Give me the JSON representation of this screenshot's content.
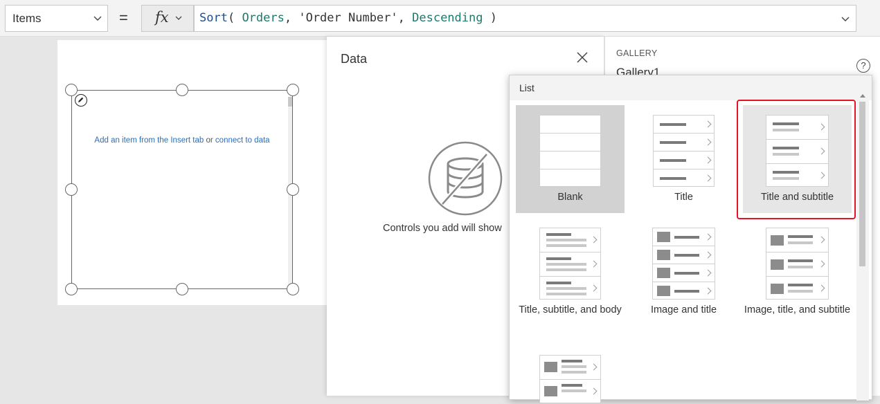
{
  "formula_bar": {
    "property": "Items",
    "equals": "=",
    "fx_label": "fx",
    "formula": {
      "fn": "Sort",
      "open": "( ",
      "arg1": "Orders",
      "sep1": ", ",
      "arg2": "'Order Number'",
      "sep2": ", ",
      "arg3": "Descending",
      "close": " )"
    }
  },
  "canvas": {
    "gallery_link1": "Add an item from the Insert tab",
    "gallery_or": " or ",
    "gallery_link2": "connect to data"
  },
  "data_pane": {
    "title": "Data",
    "hint": "Controls you add will show"
  },
  "properties": {
    "kind": "GALLERY",
    "name": "Gallery1"
  },
  "layout_flyout": {
    "title": "List",
    "tiles": [
      {
        "label": "Blank",
        "state": "selected"
      },
      {
        "label": "Title",
        "state": "normal"
      },
      {
        "label": "Title and subtitle",
        "state": "highlighted"
      },
      {
        "label": "Title, subtitle, and body",
        "state": "normal"
      },
      {
        "label": "Image and title",
        "state": "normal"
      },
      {
        "label": "Image, title, and subtitle",
        "state": "normal"
      }
    ]
  },
  "colors": {
    "highlight": "#e81123",
    "link": "#2a6ebb",
    "formula_function": "#1f4f8f",
    "formula_identifier": "#1b7a6b"
  }
}
